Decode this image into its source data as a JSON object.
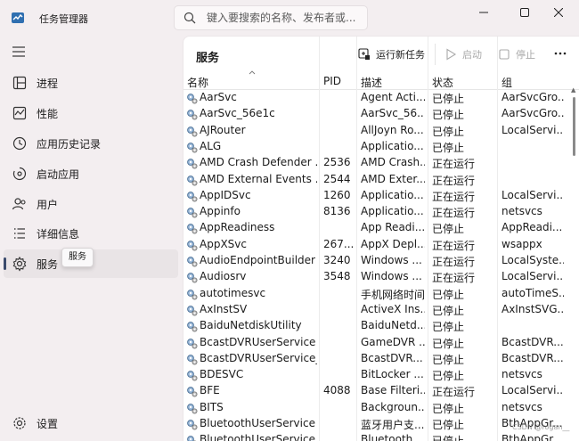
{
  "app": {
    "title": "任务管理器",
    "search_placeholder": "键入要搜索的名称、发布者或...",
    "accent": "#3a4a6c"
  },
  "sidebar": {
    "items": [
      {
        "label": "进程",
        "icon": "processes-icon"
      },
      {
        "label": "性能",
        "icon": "performance-icon"
      },
      {
        "label": "应用历史记录",
        "icon": "app-history-icon"
      },
      {
        "label": "启动应用",
        "icon": "startup-apps-icon"
      },
      {
        "label": "用户",
        "icon": "users-icon"
      },
      {
        "label": "详细信息",
        "icon": "details-icon"
      },
      {
        "label": "服务",
        "icon": "services-icon",
        "active": true
      }
    ],
    "settings_label": "设置",
    "tooltip": "服务"
  },
  "toolbar": {
    "title": "服务",
    "run_new_task": "运行新任务",
    "start": "启动",
    "stop": "停止"
  },
  "table": {
    "columns": [
      "名称",
      "PID",
      "描述",
      "状态",
      "组"
    ],
    "rows": [
      {
        "name": "AarSvc",
        "pid": "",
        "desc": "Agent Acti...",
        "status": "已停止",
        "group": "AarSvcGro..."
      },
      {
        "name": "AarSvc_56e1c",
        "pid": "",
        "desc": "AarSvc_56...",
        "status": "已停止",
        "group": "AarSvcGro..."
      },
      {
        "name": "AJRouter",
        "pid": "",
        "desc": "AllJoyn Ro...",
        "status": "已停止",
        "group": "LocalServi..."
      },
      {
        "name": "ALG",
        "pid": "",
        "desc": "Applicatio...",
        "status": "已停止",
        "group": ""
      },
      {
        "name": "AMD Crash Defender ...",
        "pid": "2536",
        "desc": "AMD Crash...",
        "status": "正在运行",
        "group": ""
      },
      {
        "name": "AMD External Events ...",
        "pid": "2544",
        "desc": "AMD Exter...",
        "status": "正在运行",
        "group": ""
      },
      {
        "name": "AppIDSvc",
        "pid": "1260",
        "desc": "Applicatio...",
        "status": "正在运行",
        "group": "LocalServi..."
      },
      {
        "name": "Appinfo",
        "pid": "8136",
        "desc": "Applicatio...",
        "status": "正在运行",
        "group": "netsvcs"
      },
      {
        "name": "AppReadiness",
        "pid": "",
        "desc": "App Readi...",
        "status": "已停止",
        "group": "AppReadi..."
      },
      {
        "name": "AppXSvc",
        "pid": "267...",
        "desc": "AppX Depl...",
        "status": "正在运行",
        "group": "wsappx"
      },
      {
        "name": "AudioEndpointBuilder",
        "pid": "3240",
        "desc": "Windows ...",
        "status": "正在运行",
        "group": "LocalSyste..."
      },
      {
        "name": "Audiosrv",
        "pid": "3548",
        "desc": "Windows ...",
        "status": "正在运行",
        "group": "LocalServi..."
      },
      {
        "name": "autotimesvc",
        "pid": "",
        "desc": "手机网络时间",
        "status": "已停止",
        "group": "autoTimeS..."
      },
      {
        "name": "AxInstSV",
        "pid": "",
        "desc": "ActiveX Ins...",
        "status": "已停止",
        "group": "AxInstSVG..."
      },
      {
        "name": "BaiduNetdiskUtility",
        "pid": "",
        "desc": "BaiduNetd...",
        "status": "已停止",
        "group": ""
      },
      {
        "name": "BcastDVRUserService",
        "pid": "",
        "desc": "GameDVR ...",
        "status": "已停止",
        "group": "BcastDVR..."
      },
      {
        "name": "BcastDVRUserService_...",
        "pid": "",
        "desc": "BcastDVR...",
        "status": "已停止",
        "group": "BcastDVR..."
      },
      {
        "name": "BDESVC",
        "pid": "",
        "desc": "BitLocker ...",
        "status": "已停止",
        "group": "netsvcs"
      },
      {
        "name": "BFE",
        "pid": "4088",
        "desc": "Base Filteri...",
        "status": "正在运行",
        "group": "LocalServi..."
      },
      {
        "name": "BITS",
        "pid": "",
        "desc": "Backgroun...",
        "status": "已停止",
        "group": "netsvcs"
      },
      {
        "name": "BluetoothUserService",
        "pid": "",
        "desc": "蓝牙用户支...",
        "status": "已停止",
        "group": "BthAppGr..."
      },
      {
        "name": "BluetoothUserService...",
        "pid": "",
        "desc": "Bluetooth ...",
        "status": "已停止",
        "group": "BthAppGr..."
      }
    ]
  },
  "watermark": "CSDN @rogan__"
}
